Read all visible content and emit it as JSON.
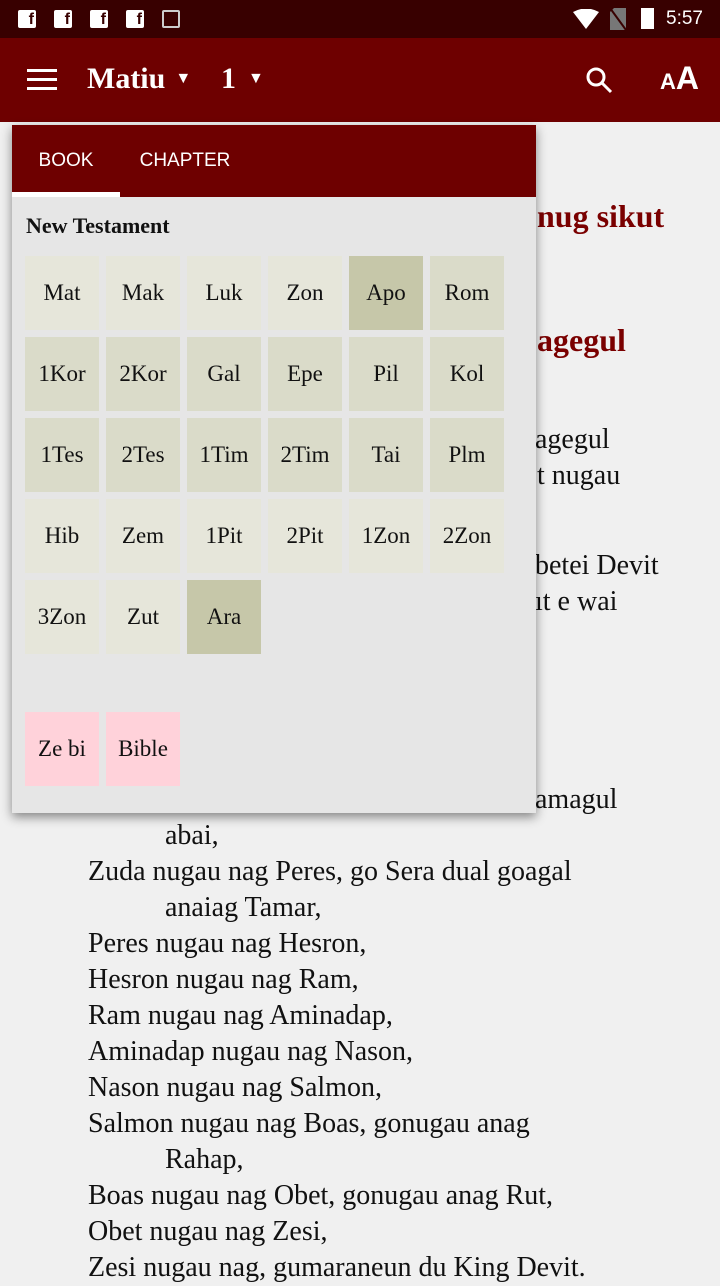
{
  "status_bar": {
    "time": "5:57",
    "notification_icons": [
      "facebook-icon",
      "facebook-icon",
      "facebook-icon",
      "facebook-icon",
      "image-icon"
    ],
    "system_icons": [
      "wifi-icon",
      "no-sim-icon",
      "battery-icon"
    ]
  },
  "app_bar": {
    "book": "Matiu",
    "chapter": "1",
    "menu_icon": "hamburger-icon",
    "search_icon": "search-icon",
    "text_size_icon": "font-size-icon"
  },
  "popup": {
    "tabs": [
      {
        "label": "BOOK",
        "selected": true
      },
      {
        "label": "CHAPTER",
        "selected": false
      }
    ],
    "section_title": "New Testament",
    "books": [
      {
        "label": "Mat",
        "shade": "light"
      },
      {
        "label": "Mak",
        "shade": "light"
      },
      {
        "label": "Luk",
        "shade": "light"
      },
      {
        "label": "Zon",
        "shade": "light"
      },
      {
        "label": "Apo",
        "shade": "dark"
      },
      {
        "label": "Rom",
        "shade": "medium"
      },
      {
        "label": "1Kor",
        "shade": "medium"
      },
      {
        "label": "2Kor",
        "shade": "medium"
      },
      {
        "label": "Gal",
        "shade": "medium"
      },
      {
        "label": "Epe",
        "shade": "medium"
      },
      {
        "label": "Pil",
        "shade": "medium"
      },
      {
        "label": "Kol",
        "shade": "medium"
      },
      {
        "label": "1Tes",
        "shade": "medium"
      },
      {
        "label": "2Tes",
        "shade": "medium"
      },
      {
        "label": "1Tim",
        "shade": "medium"
      },
      {
        "label": "2Tim",
        "shade": "medium"
      },
      {
        "label": "Tai",
        "shade": "medium"
      },
      {
        "label": "Plm",
        "shade": "medium"
      },
      {
        "label": "Hib",
        "shade": "light"
      },
      {
        "label": "Zem",
        "shade": "light"
      },
      {
        "label": "1Pit",
        "shade": "light"
      },
      {
        "label": "2Pit",
        "shade": "light"
      },
      {
        "label": "1Zon",
        "shade": "light"
      },
      {
        "label": "2Zon",
        "shade": "light"
      },
      {
        "label": "3Zon",
        "shade": "light"
      },
      {
        "label": "Zut",
        "shade": "light"
      },
      {
        "label": "Ara",
        "shade": "dark"
      }
    ],
    "extra": [
      {
        "label": "Ze bi"
      },
      {
        "label": "Bible"
      }
    ]
  },
  "colors": {
    "primary": "#6e0000",
    "status": "#380000",
    "heading": "#7a0000",
    "extra_tile": "#ffd2da"
  },
  "background_fragments": {
    "heading1": "nug sikut",
    "heading2": "agegul",
    "f1": "agegul",
    "f2": "t nugau",
    "f3": "betei Devit",
    "f4": "ıt e wai",
    "f5": "amagul"
  },
  "verses": [
    {
      "text": "abai,",
      "indent": true
    },
    {
      "text": "Zuda nugau nag Peres, go Sera dual goagal",
      "indent": false
    },
    {
      "text": "anaiag Tamar,",
      "indent": true
    },
    {
      "text": "Peres nugau nag Hesron,",
      "indent": false
    },
    {
      "text": "Hesron nugau nag Ram,",
      "indent": false
    },
    {
      "text": "Ram nugau nag Aminadap,",
      "indent": false
    },
    {
      "text": "Aminadap nugau nag Nason,",
      "indent": false
    },
    {
      "text": "Nason nugau nag Salmon,",
      "indent": false
    },
    {
      "text": "Salmon nugau nag Boas, gonugau anag",
      "indent": false
    },
    {
      "text": "Rahap,",
      "indent": true
    },
    {
      "text": "Boas nugau nag Obet, gonugau anag Rut,",
      "indent": false
    },
    {
      "text": "Obet nugau nag Zesi,",
      "indent": false
    },
    {
      "text": "Zesi nugau nag, gumaraneun du King Devit.",
      "indent": false
    }
  ]
}
